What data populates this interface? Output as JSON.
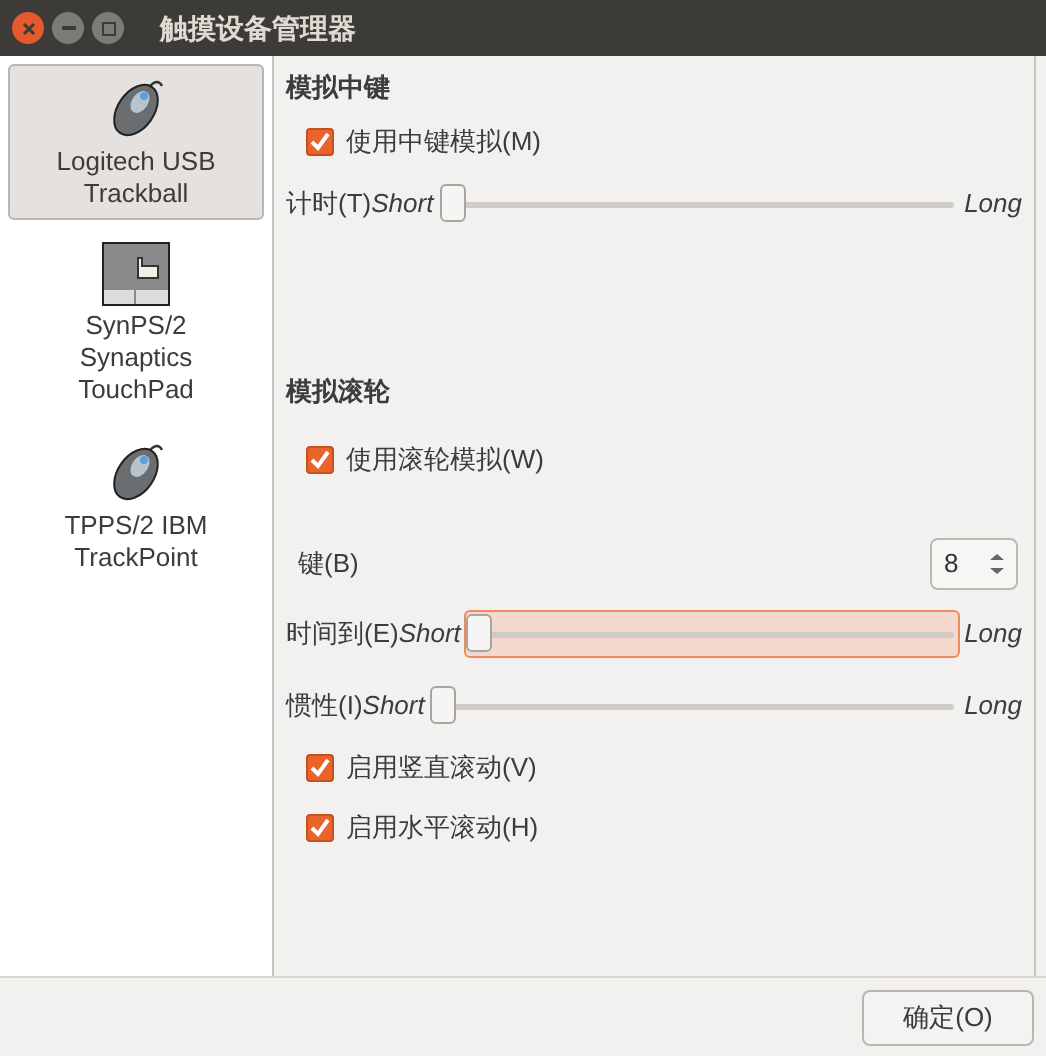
{
  "window": {
    "title": "触摸设备管理器"
  },
  "sidebar": {
    "items": [
      {
        "kind": "mouse",
        "label": "Logitech USB Trackball",
        "selected": true
      },
      {
        "kind": "touchpad",
        "label": "SynPS/2 Synaptics TouchPad",
        "selected": false
      },
      {
        "kind": "mouse",
        "label": "TPPS/2 IBM TrackPoint",
        "selected": false
      }
    ]
  },
  "sections": [
    {
      "title": "模拟中键",
      "rows": [
        {
          "kind": "checkbox",
          "label": "使用中键模拟(M)",
          "checked": true
        },
        {
          "kind": "slider",
          "label": "计时(T)",
          "min_label": "Short",
          "max_label": "Long",
          "level": 0,
          "focused": false
        }
      ]
    },
    {
      "title": "模拟滚轮",
      "rows": [
        {
          "kind": "checkbox",
          "label": "使用滚轮模拟(W)",
          "checked": true
        },
        {
          "kind": "spin",
          "label": "键(B)",
          "value": "8"
        },
        {
          "kind": "slider",
          "label": "时间到(E)",
          "min_label": "Short",
          "max_label": "Long",
          "level": 0,
          "focused": true
        },
        {
          "kind": "slider",
          "label": "惯性(I)",
          "min_label": "Short",
          "max_label": "Long",
          "level": 0,
          "focused": false
        },
        {
          "kind": "checkbox",
          "label": "启用竖直滚动(V)",
          "checked": true
        },
        {
          "kind": "checkbox",
          "label": "启用水平滚动(H)",
          "checked": true
        }
      ]
    }
  ],
  "buttons": [
    "确定(O)"
  ]
}
